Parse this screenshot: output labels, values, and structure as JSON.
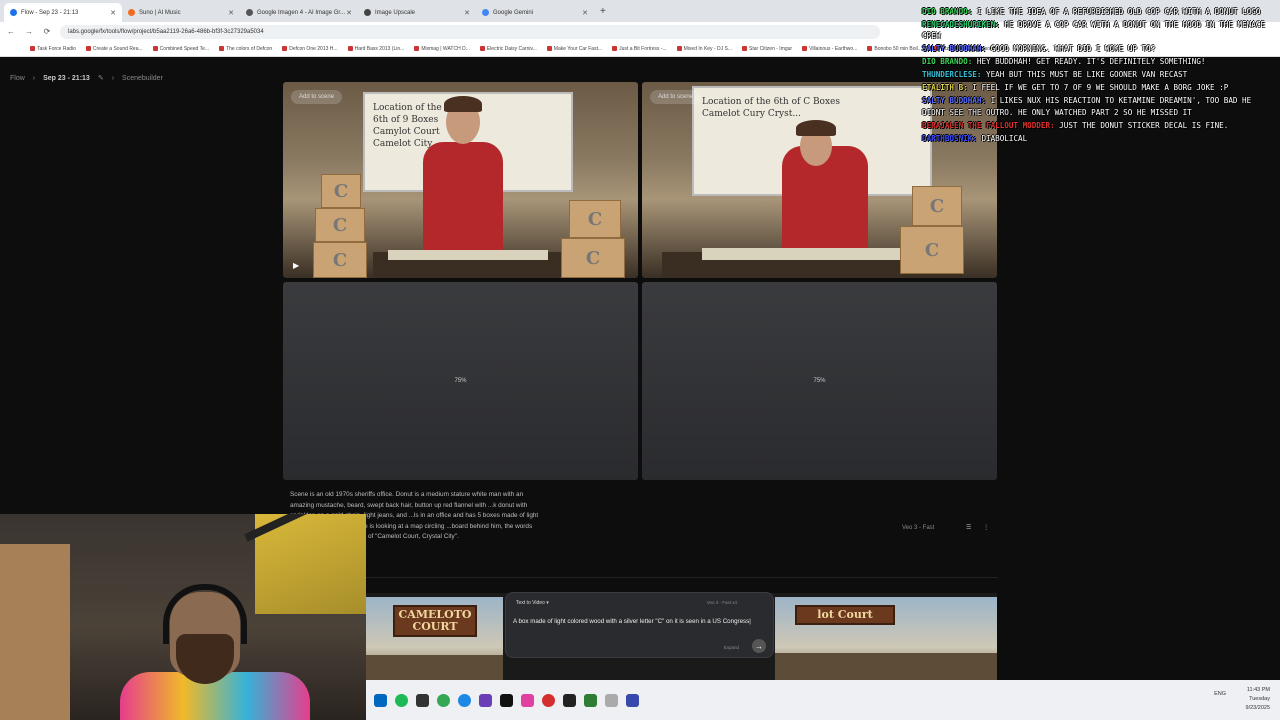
{
  "browser": {
    "tabs": [
      {
        "label": "Flow - Sep 23 - 21:13",
        "color": "#1a73e8",
        "active": true
      },
      {
        "label": "Suno | AI Music",
        "color": "#f36b21",
        "active": false
      },
      {
        "label": "Google Imagen 4 - AI Image Gr...",
        "color": "#555555",
        "active": false
      },
      {
        "label": "Image Upscale",
        "color": "#444444",
        "active": false
      },
      {
        "label": "Google Gemini",
        "color": "#4285f4",
        "active": false
      }
    ],
    "new_tab": "+",
    "url": "labs.google/fx/tools/flow/project/b5aa2119-26a6-486b-bf3f-3c27329a5034",
    "bookmarks": [
      "Task Force Radio",
      "Create a Sound Rea...",
      "Combined Speed Te...",
      "The colors of Defcon",
      "Defcon One 2013 H...",
      "Hard Bass 2013 (Lin...",
      "Mixmag | WATCH D...",
      "Electric Daisy Carniv...",
      "Make Your Car Fast...",
      "Just a Bit Fortress -...",
      "Mixed In Key - DJ S...",
      "Star Citizen - Imgur",
      "Villainous - Earthwo...",
      "Bonobo 50 min Boil...",
      "Kritz.net",
      "All Bookmarks"
    ]
  },
  "app": {
    "breadcrumb": [
      "Flow",
      "Sep 23 - 21:13",
      "Scenebuilder"
    ],
    "add_to_scene": "Add to scene",
    "clip1_board": "Location of the\n6th of 9 Boxes\nCamylot Court\nCamelot City",
    "clip2_board": "Location of the 6th of C Boxes\nCamelot Cury Cryst...",
    "box_letter": "C",
    "progress_fraction": 0.75,
    "progress_label_1": "75%",
    "progress_label_2": "75%",
    "scene_prompt": "Scene is an old 1970s sheriffs office. Donut is a medium stature white man with an amazing mustache, beard, swept back hair, button up red flannel with ...k donut with sprinkles on a gold chain, light jeans, and ...ls in an office and has 5 boxes made of light colored ...r \"C\" on them. He is looking at a map circling ...board behind him, the words \"Location of the 6th of 9 ...t of \"Camelot Court, Crystal City\".",
    "model_tag": "Veo 3 - Fast",
    "court_sign": "CAMELOTO\nCOURT",
    "court_sign_2": "lot Court",
    "composer": {
      "mode": "Text to Video",
      "model": "Veo 3 - Fast   x4",
      "prompt": "A box made of light colored wood with a silver letter \"C\" on it is seen in a US Congress|",
      "expand": "Expand",
      "send": "→"
    }
  },
  "chat": [
    {
      "user": "Dio Brando:",
      "color": "#3fd45a",
      "text": "I like the idea of a refurbished old cop car with a donut logo"
    },
    {
      "user": "RenegadeShuriken:",
      "color": "#2ecc71",
      "text": "he drove a cop car with a donut on the hood in the menace crew"
    },
    {
      "user": "Salty Buddhah:",
      "color": "#5b6cff",
      "text": "Good morning. What did I woke up to?"
    },
    {
      "user": "Dio Brando:",
      "color": "#3fd45a",
      "text": "Hey Buddhah! Get ready. It's definitely something!"
    },
    {
      "user": "Thunderclese:",
      "color": "#36c0d9",
      "text": "Yeah but this must be like gooner van recast"
    },
    {
      "user": "Etalith B:",
      "color": "#e0d34a",
      "text": "I feel if we get to 7 of 9 we should make a Borg joke :P"
    },
    {
      "user": "Salty Buddhah:",
      "color": "#5b6cff",
      "text": "I likes Nux his reaction to Ketamine Dreamin', too bad he didnt see the outro. He only watched part 2 so he missed it"
    },
    {
      "user": "Berajalen The Fallout Modder:",
      "color": "#e0302f",
      "text": "Just the donut sticker decal is fine."
    },
    {
      "user": "DarthBosnik:",
      "color": "#3b4cff",
      "text": "Diabolical"
    }
  ],
  "tray": {
    "lang": "ENG",
    "time": "11:43 PM",
    "day": "Tuesday",
    "date": "9/23/2025"
  },
  "colors": {
    "background": "#0d0d0d",
    "flannel": "#b4282b",
    "box_wood": "#c9a373"
  }
}
